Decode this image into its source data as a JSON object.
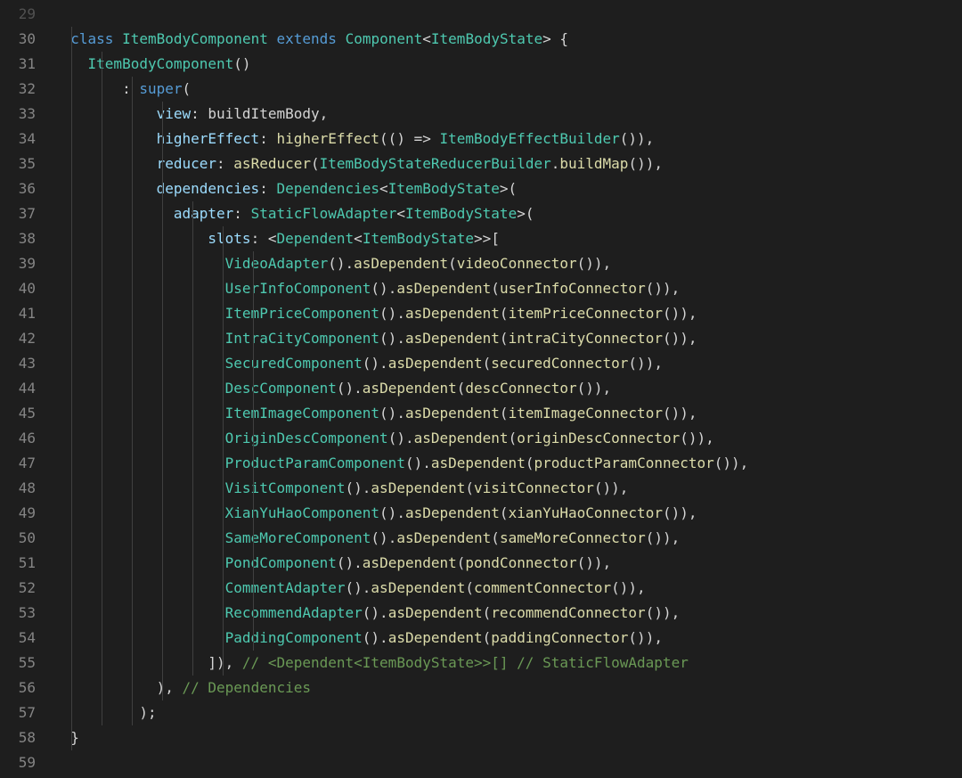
{
  "startLine": 29,
  "lines": [
    {
      "num": "29",
      "tokens": []
    },
    {
      "num": "30",
      "indents": [
        0
      ],
      "tokens": [
        {
          "t": "  ",
          "c": "default"
        },
        {
          "t": "class",
          "c": "kw-class"
        },
        {
          "t": " ",
          "c": "default"
        },
        {
          "t": "ItemBodyComponent",
          "c": "type"
        },
        {
          "t": " ",
          "c": "default"
        },
        {
          "t": "extends",
          "c": "kw-extends"
        },
        {
          "t": " ",
          "c": "default"
        },
        {
          "t": "Component",
          "c": "type"
        },
        {
          "t": "<",
          "c": "punct"
        },
        {
          "t": "ItemBodyState",
          "c": "type"
        },
        {
          "t": ">",
          "c": "punct"
        },
        {
          "t": " {",
          "c": "punct"
        }
      ]
    },
    {
      "num": "31",
      "indents": [
        0,
        1
      ],
      "tokens": [
        {
          "t": "    ",
          "c": "default"
        },
        {
          "t": "ItemBodyComponent",
          "c": "type"
        },
        {
          "t": "()",
          "c": "punct"
        }
      ]
    },
    {
      "num": "32",
      "indents": [
        0,
        1,
        2
      ],
      "tokens": [
        {
          "t": "        : ",
          "c": "punct"
        },
        {
          "t": "super",
          "c": "kw-super"
        },
        {
          "t": "(",
          "c": "punct"
        }
      ]
    },
    {
      "num": "33",
      "indents": [
        0,
        1,
        2,
        3
      ],
      "tokens": [
        {
          "t": "            ",
          "c": "default"
        },
        {
          "t": "view",
          "c": "param"
        },
        {
          "t": ": ",
          "c": "punct"
        },
        {
          "t": "buildItemBody",
          "c": "default"
        },
        {
          "t": ",",
          "c": "punct"
        }
      ]
    },
    {
      "num": "34",
      "indents": [
        0,
        1,
        2,
        3
      ],
      "tokens": [
        {
          "t": "            ",
          "c": "default"
        },
        {
          "t": "higherEffect",
          "c": "param"
        },
        {
          "t": ": ",
          "c": "punct"
        },
        {
          "t": "higherEffect",
          "c": "method"
        },
        {
          "t": "(() => ",
          "c": "punct"
        },
        {
          "t": "ItemBodyEffectBuilder",
          "c": "type"
        },
        {
          "t": "()),",
          "c": "punct"
        }
      ]
    },
    {
      "num": "35",
      "indents": [
        0,
        1,
        2,
        3
      ],
      "tokens": [
        {
          "t": "            ",
          "c": "default"
        },
        {
          "t": "reducer",
          "c": "param"
        },
        {
          "t": ": ",
          "c": "punct"
        },
        {
          "t": "asReducer",
          "c": "method"
        },
        {
          "t": "(",
          "c": "punct"
        },
        {
          "t": "ItemBodyStateReducerBuilder",
          "c": "type"
        },
        {
          "t": ".",
          "c": "punct"
        },
        {
          "t": "buildMap",
          "c": "method"
        },
        {
          "t": "()),",
          "c": "punct"
        }
      ]
    },
    {
      "num": "36",
      "indents": [
        0,
        1,
        2,
        3
      ],
      "tokens": [
        {
          "t": "            ",
          "c": "default"
        },
        {
          "t": "dependencies",
          "c": "param"
        },
        {
          "t": ": ",
          "c": "punct"
        },
        {
          "t": "Dependencies",
          "c": "type"
        },
        {
          "t": "<",
          "c": "punct"
        },
        {
          "t": "ItemBodyState",
          "c": "type"
        },
        {
          "t": ">(",
          "c": "punct"
        }
      ]
    },
    {
      "num": "37",
      "indents": [
        0,
        1,
        2,
        3,
        4
      ],
      "tokens": [
        {
          "t": "              ",
          "c": "default"
        },
        {
          "t": "adapter",
          "c": "param"
        },
        {
          "t": ": ",
          "c": "punct"
        },
        {
          "t": "StaticFlowAdapter",
          "c": "type"
        },
        {
          "t": "<",
          "c": "punct"
        },
        {
          "t": "ItemBodyState",
          "c": "type"
        },
        {
          "t": ">(",
          "c": "punct"
        }
      ]
    },
    {
      "num": "38",
      "indents": [
        0,
        1,
        2,
        3,
        4,
        5
      ],
      "tokens": [
        {
          "t": "                  ",
          "c": "default"
        },
        {
          "t": "slots",
          "c": "param"
        },
        {
          "t": ": <",
          "c": "punct"
        },
        {
          "t": "Dependent",
          "c": "type"
        },
        {
          "t": "<",
          "c": "punct"
        },
        {
          "t": "ItemBodyState",
          "c": "type"
        },
        {
          "t": ">>[",
          "c": "punct"
        }
      ]
    },
    {
      "num": "39",
      "indents": [
        0,
        1,
        2,
        3,
        4,
        5,
        6
      ],
      "tokens": [
        {
          "t": "                    ",
          "c": "default"
        },
        {
          "t": "VideoAdapter",
          "c": "type"
        },
        {
          "t": "().",
          "c": "punct"
        },
        {
          "t": "asDependent",
          "c": "method"
        },
        {
          "t": "(",
          "c": "punct"
        },
        {
          "t": "videoConnector",
          "c": "method"
        },
        {
          "t": "()),",
          "c": "punct"
        }
      ]
    },
    {
      "num": "40",
      "indents": [
        0,
        1,
        2,
        3,
        4,
        5,
        6
      ],
      "tokens": [
        {
          "t": "                    ",
          "c": "default"
        },
        {
          "t": "UserInfoComponent",
          "c": "type"
        },
        {
          "t": "().",
          "c": "punct"
        },
        {
          "t": "asDependent",
          "c": "method"
        },
        {
          "t": "(",
          "c": "punct"
        },
        {
          "t": "userInfoConnector",
          "c": "method"
        },
        {
          "t": "()),",
          "c": "punct"
        }
      ]
    },
    {
      "num": "41",
      "indents": [
        0,
        1,
        2,
        3,
        4,
        5,
        6
      ],
      "tokens": [
        {
          "t": "                    ",
          "c": "default"
        },
        {
          "t": "ItemPriceComponent",
          "c": "type"
        },
        {
          "t": "().",
          "c": "punct"
        },
        {
          "t": "asDependent",
          "c": "method"
        },
        {
          "t": "(",
          "c": "punct"
        },
        {
          "t": "itemPriceConnector",
          "c": "method"
        },
        {
          "t": "()),",
          "c": "punct"
        }
      ]
    },
    {
      "num": "42",
      "indents": [
        0,
        1,
        2,
        3,
        4,
        5,
        6
      ],
      "tokens": [
        {
          "t": "                    ",
          "c": "default"
        },
        {
          "t": "IntraCityComponent",
          "c": "type"
        },
        {
          "t": "().",
          "c": "punct"
        },
        {
          "t": "asDependent",
          "c": "method"
        },
        {
          "t": "(",
          "c": "punct"
        },
        {
          "t": "intraCityConnector",
          "c": "method"
        },
        {
          "t": "()),",
          "c": "punct"
        }
      ]
    },
    {
      "num": "43",
      "indents": [
        0,
        1,
        2,
        3,
        4,
        5,
        6
      ],
      "tokens": [
        {
          "t": "                    ",
          "c": "default"
        },
        {
          "t": "SecuredComponent",
          "c": "type"
        },
        {
          "t": "().",
          "c": "punct"
        },
        {
          "t": "asDependent",
          "c": "method"
        },
        {
          "t": "(",
          "c": "punct"
        },
        {
          "t": "securedConnector",
          "c": "method"
        },
        {
          "t": "()),",
          "c": "punct"
        }
      ]
    },
    {
      "num": "44",
      "indents": [
        0,
        1,
        2,
        3,
        4,
        5,
        6
      ],
      "tokens": [
        {
          "t": "                    ",
          "c": "default"
        },
        {
          "t": "DescComponent",
          "c": "type"
        },
        {
          "t": "().",
          "c": "punct"
        },
        {
          "t": "asDependent",
          "c": "method"
        },
        {
          "t": "(",
          "c": "punct"
        },
        {
          "t": "descConnector",
          "c": "method"
        },
        {
          "t": "()),",
          "c": "punct"
        }
      ]
    },
    {
      "num": "45",
      "indents": [
        0,
        1,
        2,
        3,
        4,
        5,
        6
      ],
      "tokens": [
        {
          "t": "                    ",
          "c": "default"
        },
        {
          "t": "ItemImageComponent",
          "c": "type"
        },
        {
          "t": "().",
          "c": "punct"
        },
        {
          "t": "asDependent",
          "c": "method"
        },
        {
          "t": "(",
          "c": "punct"
        },
        {
          "t": "itemImageConnector",
          "c": "method"
        },
        {
          "t": "()),",
          "c": "punct"
        }
      ]
    },
    {
      "num": "46",
      "indents": [
        0,
        1,
        2,
        3,
        4,
        5,
        6
      ],
      "tokens": [
        {
          "t": "                    ",
          "c": "default"
        },
        {
          "t": "OriginDescComponent",
          "c": "type"
        },
        {
          "t": "().",
          "c": "punct"
        },
        {
          "t": "asDependent",
          "c": "method"
        },
        {
          "t": "(",
          "c": "punct"
        },
        {
          "t": "originDescConnector",
          "c": "method"
        },
        {
          "t": "()),",
          "c": "punct"
        }
      ]
    },
    {
      "num": "47",
      "indents": [
        0,
        1,
        2,
        3,
        4,
        5,
        6
      ],
      "tokens": [
        {
          "t": "                    ",
          "c": "default"
        },
        {
          "t": "ProductParamComponent",
          "c": "type"
        },
        {
          "t": "().",
          "c": "punct"
        },
        {
          "t": "asDependent",
          "c": "method"
        },
        {
          "t": "(",
          "c": "punct"
        },
        {
          "t": "productParamConnector",
          "c": "method"
        },
        {
          "t": "()),",
          "c": "punct"
        }
      ]
    },
    {
      "num": "48",
      "indents": [
        0,
        1,
        2,
        3,
        4,
        5,
        6
      ],
      "tokens": [
        {
          "t": "                    ",
          "c": "default"
        },
        {
          "t": "VisitComponent",
          "c": "type"
        },
        {
          "t": "().",
          "c": "punct"
        },
        {
          "t": "asDependent",
          "c": "method"
        },
        {
          "t": "(",
          "c": "punct"
        },
        {
          "t": "visitConnector",
          "c": "method"
        },
        {
          "t": "()),",
          "c": "punct"
        }
      ]
    },
    {
      "num": "49",
      "indents": [
        0,
        1,
        2,
        3,
        4,
        5,
        6
      ],
      "tokens": [
        {
          "t": "                    ",
          "c": "default"
        },
        {
          "t": "XianYuHaoComponent",
          "c": "type"
        },
        {
          "t": "().",
          "c": "punct"
        },
        {
          "t": "asDependent",
          "c": "method"
        },
        {
          "t": "(",
          "c": "punct"
        },
        {
          "t": "xianYuHaoConnector",
          "c": "method"
        },
        {
          "t": "()),",
          "c": "punct"
        }
      ]
    },
    {
      "num": "50",
      "indents": [
        0,
        1,
        2,
        3,
        4,
        5,
        6
      ],
      "tokens": [
        {
          "t": "                    ",
          "c": "default"
        },
        {
          "t": "SameMoreComponent",
          "c": "type"
        },
        {
          "t": "().",
          "c": "punct"
        },
        {
          "t": "asDependent",
          "c": "method"
        },
        {
          "t": "(",
          "c": "punct"
        },
        {
          "t": "sameMoreConnector",
          "c": "method"
        },
        {
          "t": "()),",
          "c": "punct"
        }
      ]
    },
    {
      "num": "51",
      "indents": [
        0,
        1,
        2,
        3,
        4,
        5,
        6
      ],
      "tokens": [
        {
          "t": "                    ",
          "c": "default"
        },
        {
          "t": "PondComponent",
          "c": "type"
        },
        {
          "t": "().",
          "c": "punct"
        },
        {
          "t": "asDependent",
          "c": "method"
        },
        {
          "t": "(",
          "c": "punct"
        },
        {
          "t": "pondConnector",
          "c": "method"
        },
        {
          "t": "()),",
          "c": "punct"
        }
      ]
    },
    {
      "num": "52",
      "indents": [
        0,
        1,
        2,
        3,
        4,
        5,
        6
      ],
      "tokens": [
        {
          "t": "                    ",
          "c": "default"
        },
        {
          "t": "CommentAdapter",
          "c": "type"
        },
        {
          "t": "().",
          "c": "punct"
        },
        {
          "t": "asDependent",
          "c": "method"
        },
        {
          "t": "(",
          "c": "punct"
        },
        {
          "t": "commentConnector",
          "c": "method"
        },
        {
          "t": "()),",
          "c": "punct"
        }
      ]
    },
    {
      "num": "53",
      "indents": [
        0,
        1,
        2,
        3,
        4,
        5,
        6
      ],
      "tokens": [
        {
          "t": "                    ",
          "c": "default"
        },
        {
          "t": "RecommendAdapter",
          "c": "type"
        },
        {
          "t": "().",
          "c": "punct"
        },
        {
          "t": "asDependent",
          "c": "method"
        },
        {
          "t": "(",
          "c": "punct"
        },
        {
          "t": "recommendConnector",
          "c": "method"
        },
        {
          "t": "()),",
          "c": "punct"
        }
      ]
    },
    {
      "num": "54",
      "indents": [
        0,
        1,
        2,
        3,
        4,
        5,
        6
      ],
      "tokens": [
        {
          "t": "                    ",
          "c": "default"
        },
        {
          "t": "PaddingComponent",
          "c": "type"
        },
        {
          "t": "().",
          "c": "punct"
        },
        {
          "t": "asDependent",
          "c": "method"
        },
        {
          "t": "(",
          "c": "punct"
        },
        {
          "t": "paddingConnector",
          "c": "method"
        },
        {
          "t": "()),",
          "c": "punct"
        }
      ]
    },
    {
      "num": "55",
      "indents": [
        0,
        1,
        2,
        3,
        4,
        5
      ],
      "tokens": [
        {
          "t": "                  ]), ",
          "c": "punct"
        },
        {
          "t": "// <Dependent<ItemBodyState>>[] // StaticFlowAdapter",
          "c": "comment"
        }
      ]
    },
    {
      "num": "56",
      "indents": [
        0,
        1,
        2,
        3
      ],
      "tokens": [
        {
          "t": "            ), ",
          "c": "punct"
        },
        {
          "t": "// Dependencies",
          "c": "comment"
        }
      ]
    },
    {
      "num": "57",
      "indents": [
        0,
        1,
        2
      ],
      "tokens": [
        {
          "t": "          );",
          "c": "punct"
        }
      ]
    },
    {
      "num": "58",
      "indents": [
        0
      ],
      "tokens": [
        {
          "t": "  }",
          "c": "punct"
        }
      ]
    },
    {
      "num": "59",
      "tokens": []
    }
  ],
  "indentPositions": [
    20,
    54,
    88,
    122,
    156,
    190,
    224
  ]
}
